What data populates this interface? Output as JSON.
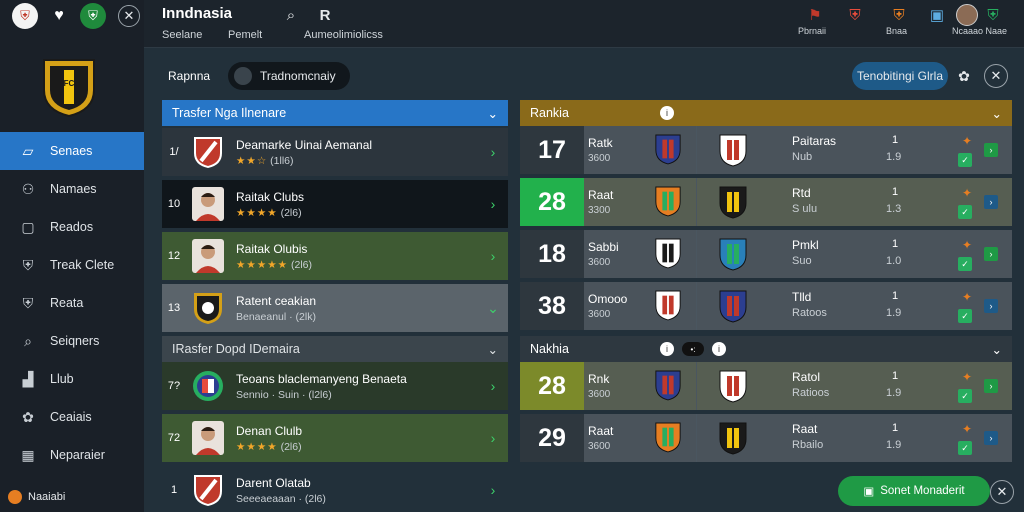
{
  "app": {
    "title": "Inndnasia",
    "sub_left": "Seelane",
    "sub_mid": "Pemelt",
    "sub_right": "Aumeolimiolicss",
    "badges": [
      "Pbrnaii",
      "Bnaa",
      "Ncaaao Naae"
    ]
  },
  "sidebar": {
    "items": [
      {
        "label": "Senaes",
        "icon": "shirt-icon",
        "active": true
      },
      {
        "label": "Namaes",
        "icon": "team-icon",
        "active": false
      },
      {
        "label": "Reados",
        "icon": "document-icon",
        "active": false
      },
      {
        "label": "Treak Clete",
        "icon": "club-crest-icon",
        "active": false
      },
      {
        "label": "Reata",
        "icon": "club-crest-icon",
        "active": false
      },
      {
        "label": "Seiqners",
        "icon": "search-icon",
        "active": false
      },
      {
        "label": "Llub",
        "icon": "chart-icon",
        "active": false
      },
      {
        "label": "Ceaiais",
        "icon": "settings-icon",
        "active": false
      },
      {
        "label": "Neparaier",
        "icon": "calendar-icon",
        "active": false
      }
    ],
    "footer": "Naaiabi"
  },
  "subrow": {
    "left_label": "Rapnna",
    "toggle_label": "Tradnomcnaiy",
    "right_button": "Tenobitingi Glrla"
  },
  "transfer_panel_1": {
    "title": "Trasfer Nga Ilnenare",
    "rows": [
      {
        "num": "1/",
        "name": "Deamarke Uinai Aemanal",
        "stars": "★★☆",
        "rating": "(1ll6)",
        "kind": "crest-red"
      },
      {
        "num": "10",
        "name": "Raitak Clubs",
        "stars": "★★★★",
        "rating": "(2l6)",
        "kind": "player"
      },
      {
        "num": "12",
        "name": "Raitak Olubis",
        "stars": "★★★★★",
        "rating": "(2l6)",
        "kind": "player"
      },
      {
        "num": "13",
        "name": "Ratent ceakian",
        "stars": "",
        "rating": "Benaeanul · (2lk)",
        "kind": "crest-dark"
      }
    ]
  },
  "transfer_panel_2": {
    "title": "IRasfer Dopd IDemaira",
    "rows": [
      {
        "num": "7?",
        "name": "Teoans blaclemanyeng Benaeta",
        "stars": "",
        "rating": "Sennio · Suin · (l2l6)",
        "kind": "crest-multi"
      },
      {
        "num": "72",
        "name": "Denan Clulb",
        "stars": "★★★★",
        "rating": "(2l6)",
        "kind": "player"
      },
      {
        "num": "1",
        "name": "Darent Olatab",
        "stars": "",
        "rating": "Seeeaeaaan · (2l6)",
        "kind": "crest-red"
      }
    ]
  },
  "rank_panel_1": {
    "title": "Rankia",
    "rows": [
      {
        "rank": "17",
        "abbr": "Ratk",
        "score": "3600",
        "name": "Paitaras",
        "club": "Nub",
        "v1": "1",
        "v2": "1.9",
        "highlight": false
      },
      {
        "rank": "28",
        "abbr": "Raat",
        "score": "3300",
        "name": "Rtd",
        "club": "S ulu",
        "v1": "1",
        "v2": "1.3",
        "highlight": true
      },
      {
        "rank": "18",
        "abbr": "Sabbi",
        "score": "3600",
        "name": "Pmkl",
        "club": "Suo",
        "v1": "1",
        "v2": "1.0",
        "highlight": false
      },
      {
        "rank": "38",
        "abbr": "Omooo",
        "score": "3600",
        "name": "Tlld",
        "club": "Ratoos",
        "v1": "1",
        "v2": "1.9",
        "highlight": false
      }
    ]
  },
  "rank_panel_2": {
    "title": "Nakhia",
    "rows": [
      {
        "rank": "28",
        "abbr": "Rnk",
        "score": "3600",
        "name": "Ratol",
        "club": "Ratioos",
        "v1": "1",
        "v2": "1.9",
        "highlight": true
      },
      {
        "rank": "29",
        "abbr": "Raat",
        "score": "3600",
        "name": "Raat",
        "club": "Rbailo",
        "v1": "1",
        "v2": "1.9",
        "highlight": false
      }
    ]
  },
  "fab": {
    "label": "Sonet Monaderit"
  },
  "colors": {
    "accent": "#2776c7",
    "green": "#22b14c",
    "olive": "#8a6a1a",
    "dark": "#1a2028"
  }
}
